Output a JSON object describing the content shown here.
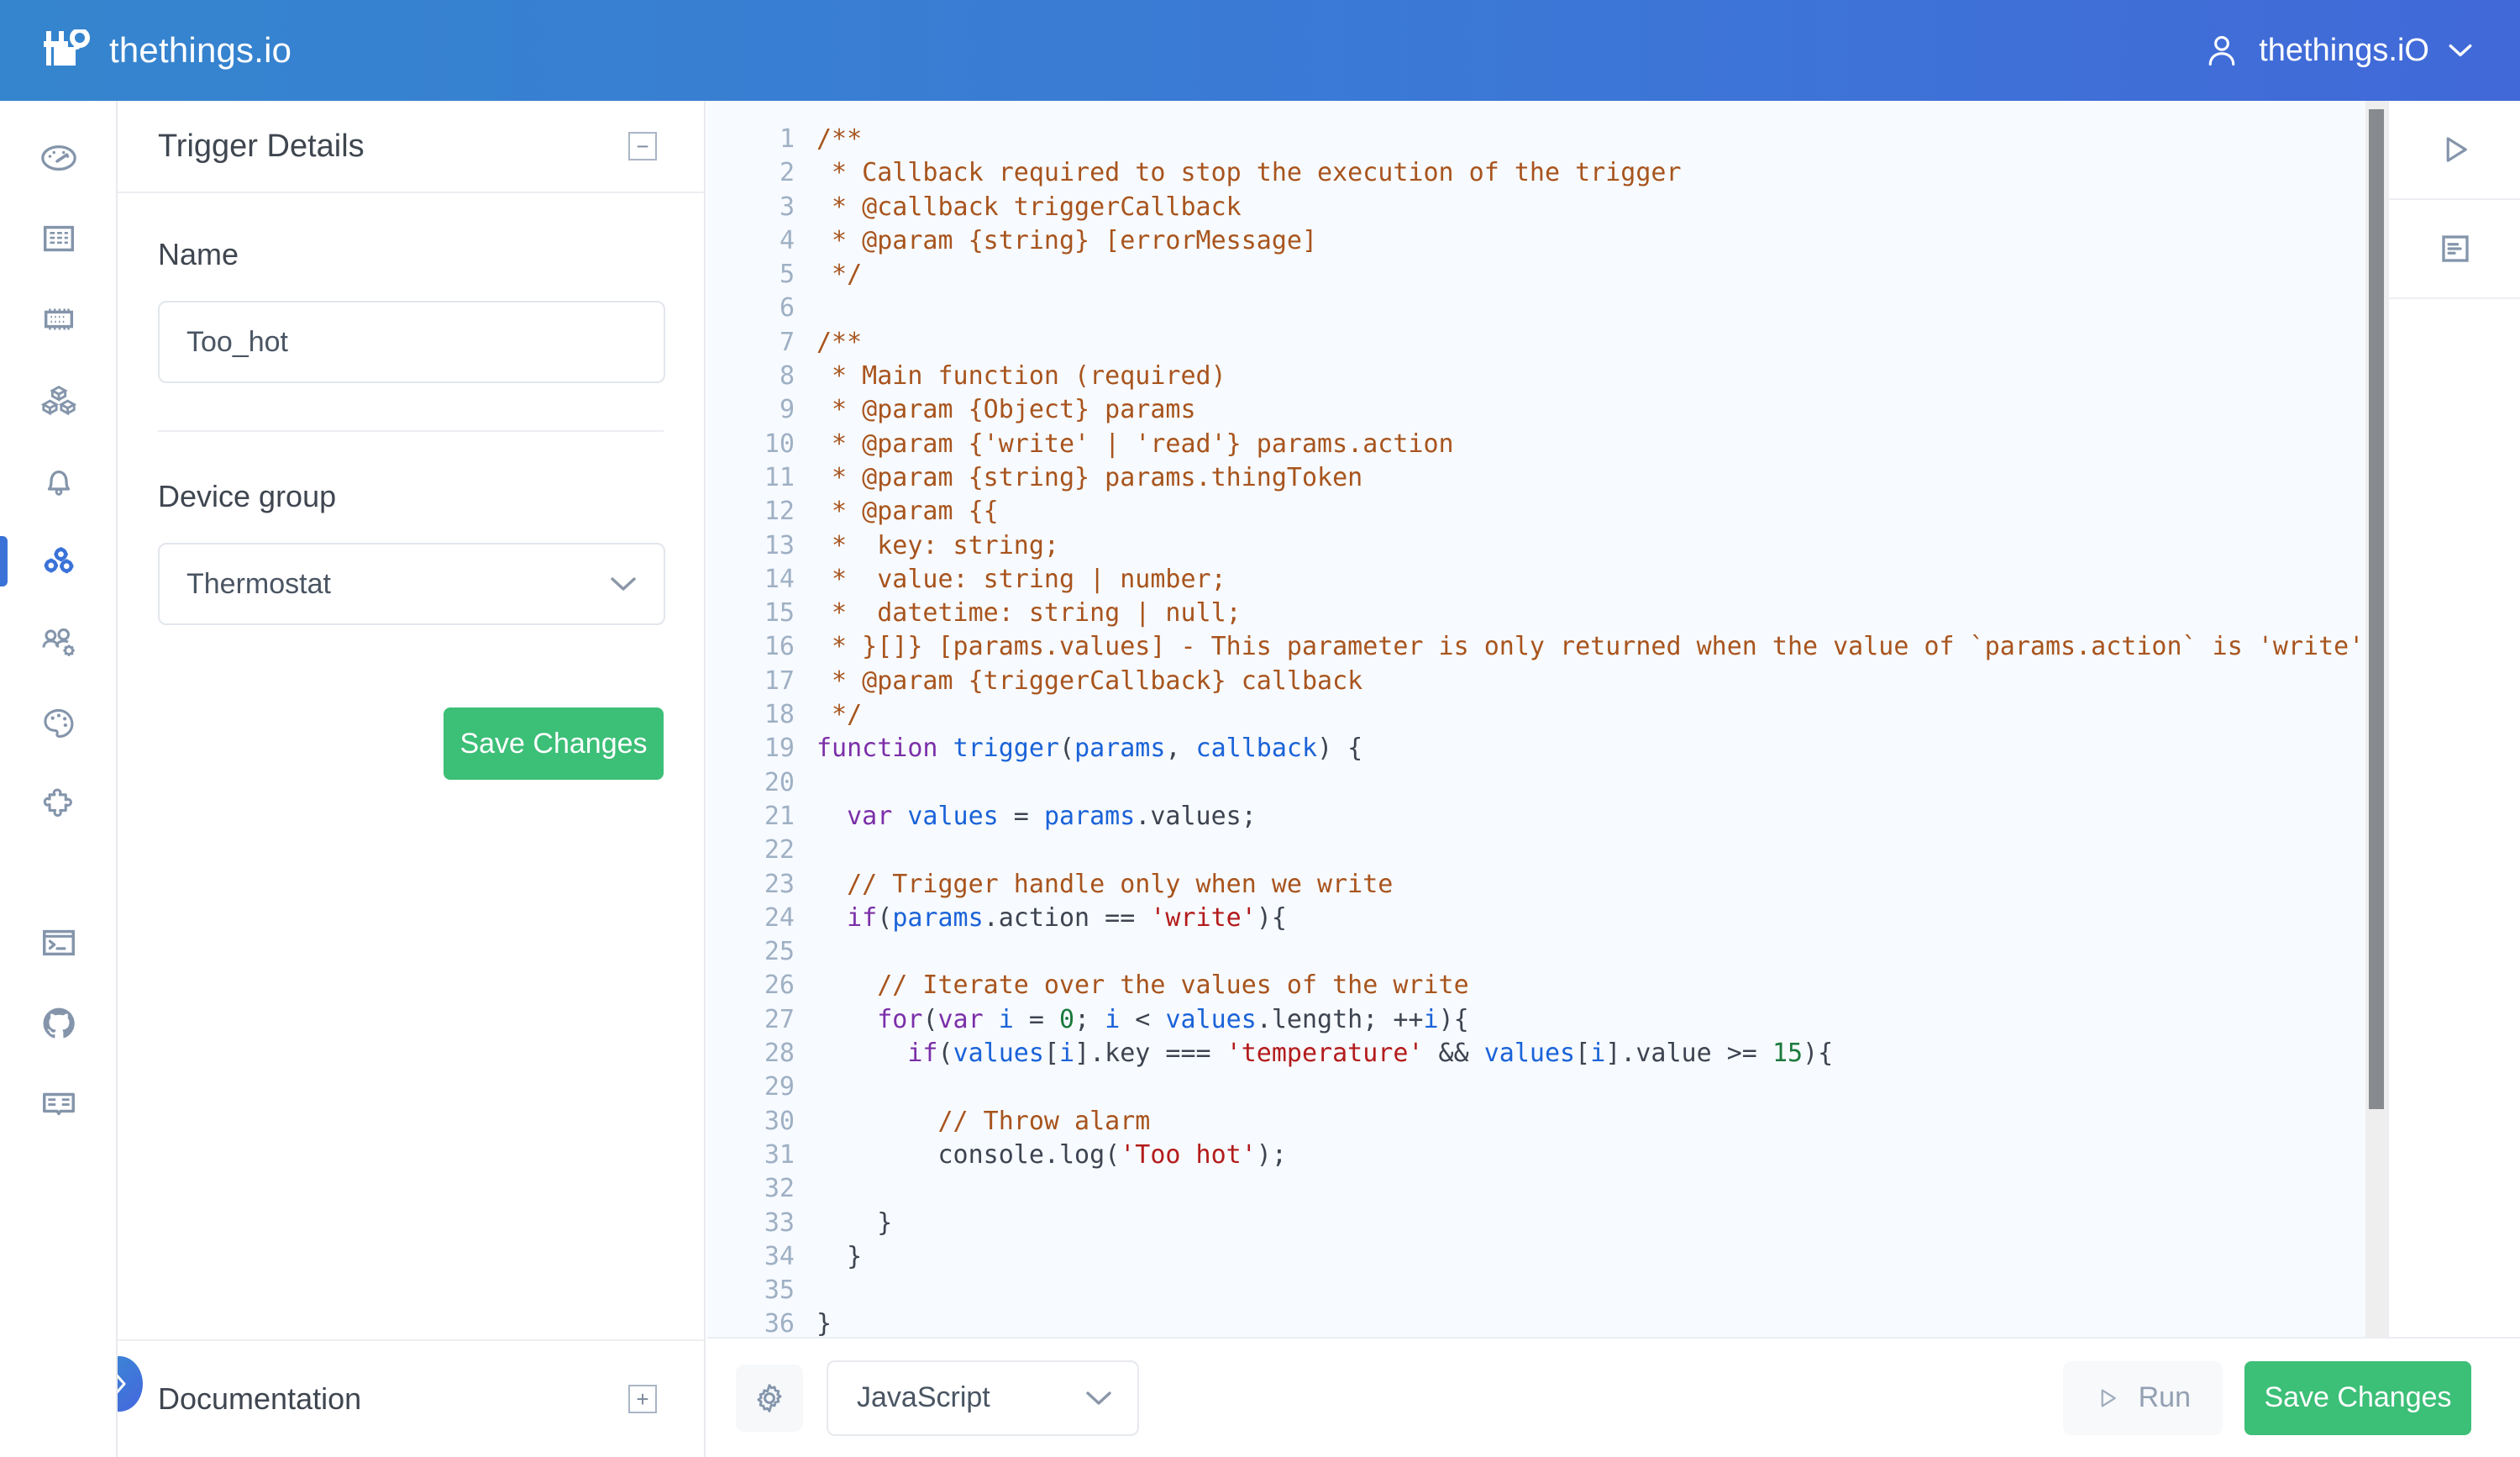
{
  "header": {
    "brand_name": "thethings.io",
    "brand_logo_icon": "thethings-logo-icon",
    "user_name": "thethings.iO",
    "user_avatar_icon": "user-avatar-icon",
    "user_caret_icon": "chevron-down-icon",
    "gradient_from": "#3585ce",
    "gradient_to": "#4169d8"
  },
  "sidebar": {
    "items": [
      {
        "name": "dashboard",
        "icon": "gauge-icon",
        "active": false
      },
      {
        "name": "buildings",
        "icon": "building-icon",
        "active": false
      },
      {
        "name": "things",
        "icon": "chip-icon",
        "active": false
      },
      {
        "name": "products",
        "icon": "cubes-icon",
        "active": false
      },
      {
        "name": "alerts",
        "icon": "bell-icon",
        "active": false
      },
      {
        "name": "triggers",
        "icon": "gear-cluster-icon",
        "active": true
      },
      {
        "name": "users",
        "icon": "users-settings-icon",
        "active": false
      },
      {
        "name": "theme",
        "icon": "palette-icon",
        "active": false
      },
      {
        "name": "plugins",
        "icon": "puzzle-icon",
        "active": false
      }
    ],
    "bottom_items": [
      {
        "name": "console",
        "icon": "terminal-icon"
      },
      {
        "name": "github",
        "icon": "github-icon"
      },
      {
        "name": "documentation",
        "icon": "book-icon"
      }
    ],
    "active_color": "#3a72d8"
  },
  "detail_panel": {
    "title": "Trigger Details",
    "collapse_icon": "minus-box-icon",
    "collapse_glyph": "−",
    "name_label": "Name",
    "name_value": "Too_hot",
    "name_placeholder": "Name",
    "device_group_label": "Device group",
    "device_group_value": "Thermostat",
    "device_group_caret_icon": "chevron-down-icon",
    "save_label": "Save Changes",
    "save_color": "#3cbf77",
    "footer_title": "Documentation",
    "footer_expand_icon": "plus-box-icon",
    "footer_expand_glyph": "+",
    "fab_icon": "chevron-right-icon"
  },
  "editor": {
    "language": "JavaScript",
    "language_caret_icon": "chevron-down-icon",
    "settings_icon": "gear-icon",
    "run_label": "Run",
    "run_icon": "play-icon",
    "save_label": "Save Changes",
    "save_color": "#3cbf77",
    "tool_rail": [
      {
        "name": "run",
        "icon": "play-icon"
      },
      {
        "name": "logs",
        "icon": "log-document-icon"
      }
    ],
    "scrollbar": {
      "thumb_color": "#878a8e",
      "track_color": "#eeeeee"
    },
    "theme": {
      "background": "#f7faff",
      "line_number": "#9fb0c4",
      "comment": "#a8541d",
      "keyword": "#7b2fa8",
      "identifier": "#1a63d8",
      "string": "#b31b1b",
      "number": "#1a7a3c",
      "plain": "#3d4450"
    },
    "code_lines": [
      {
        "n": 1,
        "tokens": [
          {
            "t": "cmt",
            "s": "/**"
          }
        ]
      },
      {
        "n": 2,
        "tokens": [
          {
            "t": "cmt",
            "s": " * Callback required to stop the execution of the trigger"
          }
        ]
      },
      {
        "n": 3,
        "tokens": [
          {
            "t": "cmt",
            "s": " * @callback triggerCallback"
          }
        ]
      },
      {
        "n": 4,
        "tokens": [
          {
            "t": "cmt",
            "s": " * @param {string} [errorMessage]"
          }
        ]
      },
      {
        "n": 5,
        "tokens": [
          {
            "t": "cmt",
            "s": " */"
          }
        ]
      },
      {
        "n": 6,
        "tokens": []
      },
      {
        "n": 7,
        "tokens": [
          {
            "t": "cmt",
            "s": "/**"
          }
        ]
      },
      {
        "n": 8,
        "tokens": [
          {
            "t": "cmt",
            "s": " * Main function (required)"
          }
        ]
      },
      {
        "n": 9,
        "tokens": [
          {
            "t": "cmt",
            "s": " * @param {Object} params"
          }
        ]
      },
      {
        "n": 10,
        "tokens": [
          {
            "t": "cmt",
            "s": " * @param {'write' | 'read'} params.action"
          }
        ]
      },
      {
        "n": 11,
        "tokens": [
          {
            "t": "cmt",
            "s": " * @param {string} params.thingToken"
          }
        ]
      },
      {
        "n": 12,
        "tokens": [
          {
            "t": "cmt",
            "s": " * @param {{"
          }
        ]
      },
      {
        "n": 13,
        "tokens": [
          {
            "t": "cmt",
            "s": " *  key: string;"
          }
        ]
      },
      {
        "n": 14,
        "tokens": [
          {
            "t": "cmt",
            "s": " *  value: string | number;"
          }
        ]
      },
      {
        "n": 15,
        "tokens": [
          {
            "t": "cmt",
            "s": " *  datetime: string | null;"
          }
        ]
      },
      {
        "n": 16,
        "tokens": [
          {
            "t": "cmt",
            "s": " * }[]} [params.values] - This parameter is only returned when the value of `params.action` is 'write'"
          }
        ]
      },
      {
        "n": 17,
        "tokens": [
          {
            "t": "cmt",
            "s": " * @param {triggerCallback} callback"
          }
        ]
      },
      {
        "n": 18,
        "tokens": [
          {
            "t": "cmt",
            "s": " */"
          }
        ]
      },
      {
        "n": 19,
        "tokens": [
          {
            "t": "kw",
            "s": "function"
          },
          {
            "t": "pln",
            "s": " "
          },
          {
            "t": "id",
            "s": "trigger"
          },
          {
            "t": "pln",
            "s": "("
          },
          {
            "t": "id",
            "s": "params"
          },
          {
            "t": "pln",
            "s": ", "
          },
          {
            "t": "id",
            "s": "callback"
          },
          {
            "t": "pln",
            "s": ") {"
          }
        ]
      },
      {
        "n": 20,
        "tokens": []
      },
      {
        "n": 21,
        "tokens": [
          {
            "t": "pln",
            "s": "  "
          },
          {
            "t": "kw",
            "s": "var"
          },
          {
            "t": "pln",
            "s": " "
          },
          {
            "t": "id",
            "s": "values"
          },
          {
            "t": "pln",
            "s": " = "
          },
          {
            "t": "id",
            "s": "params"
          },
          {
            "t": "pln",
            "s": ".values;"
          }
        ]
      },
      {
        "n": 22,
        "tokens": []
      },
      {
        "n": 23,
        "tokens": [
          {
            "t": "pln",
            "s": "  "
          },
          {
            "t": "cmt",
            "s": "// Trigger handle only when we write"
          }
        ]
      },
      {
        "n": 24,
        "tokens": [
          {
            "t": "pln",
            "s": "  "
          },
          {
            "t": "kw",
            "s": "if"
          },
          {
            "t": "pln",
            "s": "("
          },
          {
            "t": "id",
            "s": "params"
          },
          {
            "t": "pln",
            "s": ".action == "
          },
          {
            "t": "str",
            "s": "'write'"
          },
          {
            "t": "pln",
            "s": "){"
          }
        ]
      },
      {
        "n": 25,
        "tokens": []
      },
      {
        "n": 26,
        "tokens": [
          {
            "t": "pln",
            "s": "    "
          },
          {
            "t": "cmt",
            "s": "// Iterate over the values of the write"
          }
        ]
      },
      {
        "n": 27,
        "tokens": [
          {
            "t": "pln",
            "s": "    "
          },
          {
            "t": "kw",
            "s": "for"
          },
          {
            "t": "pln",
            "s": "("
          },
          {
            "t": "kw",
            "s": "var"
          },
          {
            "t": "pln",
            "s": " "
          },
          {
            "t": "id",
            "s": "i"
          },
          {
            "t": "pln",
            "s": " = "
          },
          {
            "t": "num",
            "s": "0"
          },
          {
            "t": "pln",
            "s": "; "
          },
          {
            "t": "id",
            "s": "i"
          },
          {
            "t": "pln",
            "s": " < "
          },
          {
            "t": "id",
            "s": "values"
          },
          {
            "t": "pln",
            "s": ".length; ++"
          },
          {
            "t": "id",
            "s": "i"
          },
          {
            "t": "pln",
            "s": "){"
          }
        ]
      },
      {
        "n": 28,
        "tokens": [
          {
            "t": "pln",
            "s": "      "
          },
          {
            "t": "kw",
            "s": "if"
          },
          {
            "t": "pln",
            "s": "("
          },
          {
            "t": "id",
            "s": "values"
          },
          {
            "t": "pln",
            "s": "["
          },
          {
            "t": "id",
            "s": "i"
          },
          {
            "t": "pln",
            "s": "].key === "
          },
          {
            "t": "str",
            "s": "'temperature'"
          },
          {
            "t": "pln",
            "s": " && "
          },
          {
            "t": "id",
            "s": "values"
          },
          {
            "t": "pln",
            "s": "["
          },
          {
            "t": "id",
            "s": "i"
          },
          {
            "t": "pln",
            "s": "].value >= "
          },
          {
            "t": "num",
            "s": "15"
          },
          {
            "t": "pln",
            "s": "){"
          }
        ]
      },
      {
        "n": 29,
        "tokens": []
      },
      {
        "n": 30,
        "tokens": [
          {
            "t": "pln",
            "s": "        "
          },
          {
            "t": "cmt",
            "s": "// Throw alarm"
          }
        ]
      },
      {
        "n": 31,
        "tokens": [
          {
            "t": "pln",
            "s": "        console.log("
          },
          {
            "t": "str",
            "s": "'Too hot'"
          },
          {
            "t": "pln",
            "s": ");"
          }
        ]
      },
      {
        "n": 32,
        "tokens": []
      },
      {
        "n": 33,
        "tokens": [
          {
            "t": "pln",
            "s": "    }"
          }
        ]
      },
      {
        "n": 34,
        "tokens": [
          {
            "t": "pln",
            "s": "  }"
          }
        ]
      },
      {
        "n": 35,
        "tokens": []
      },
      {
        "n": 36,
        "tokens": [
          {
            "t": "pln",
            "s": "}"
          }
        ]
      }
    ]
  }
}
